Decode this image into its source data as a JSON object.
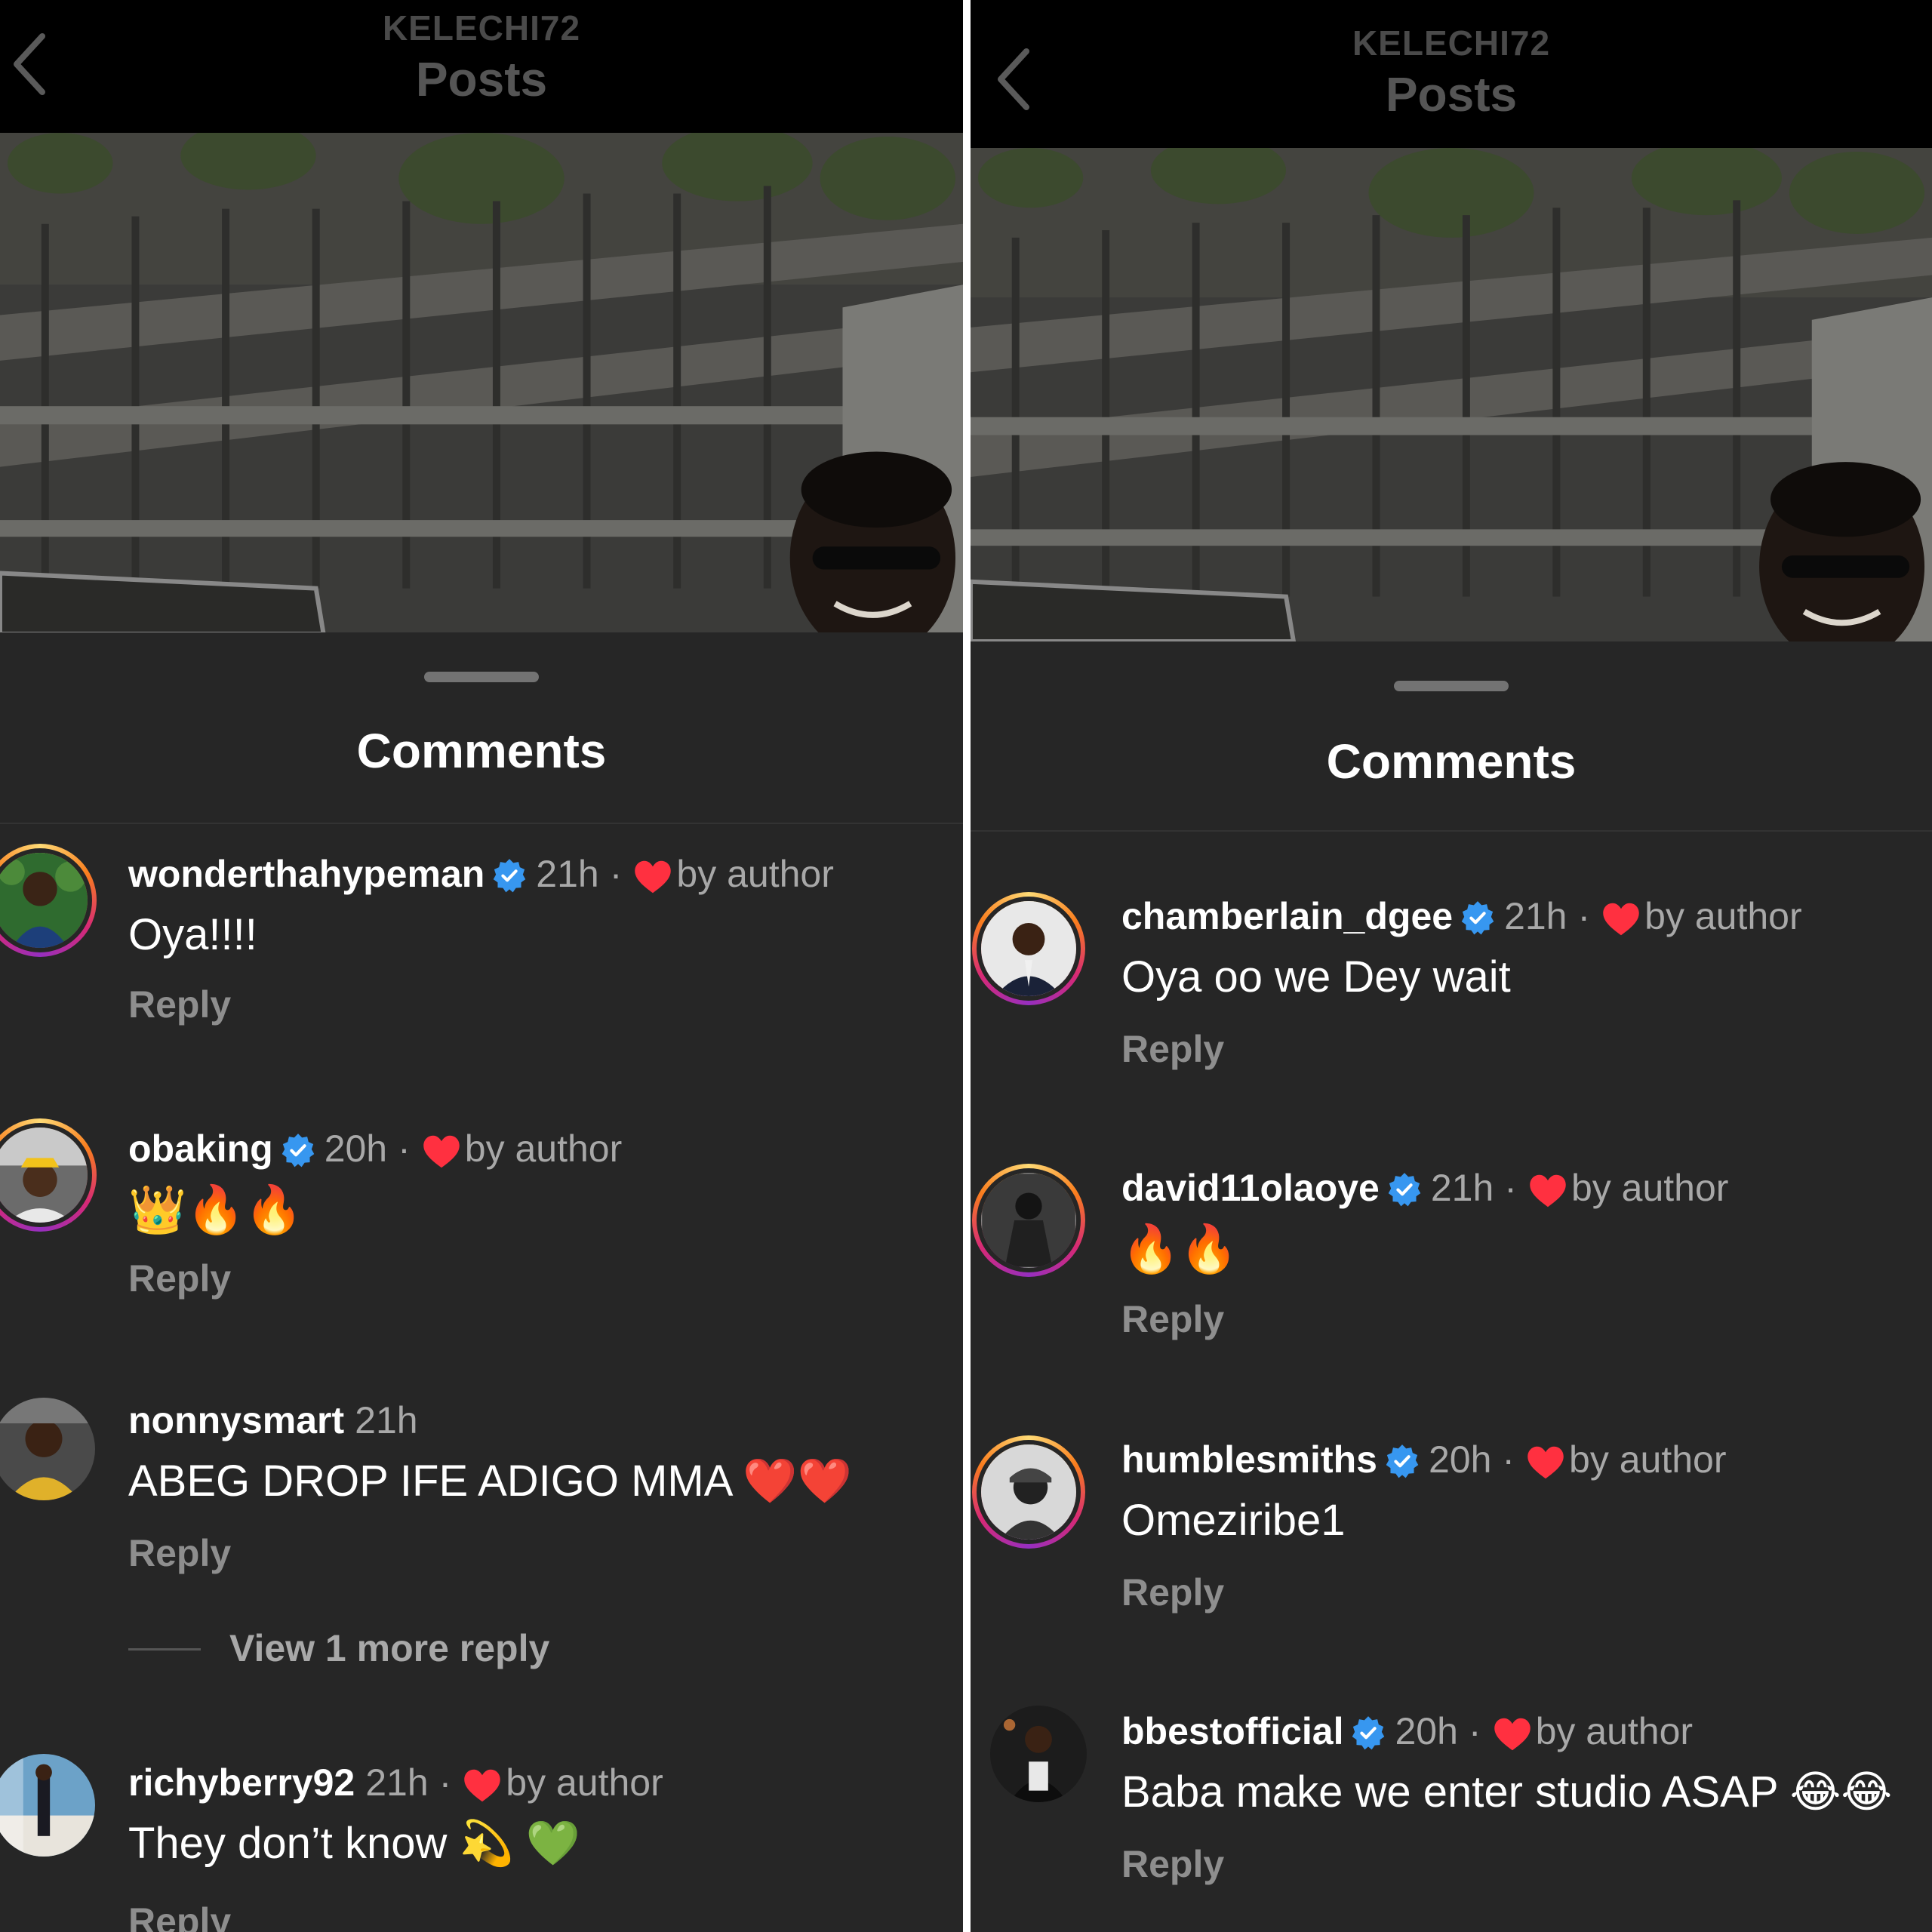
{
  "header": {
    "owner": "KELECHI72",
    "title": "Posts"
  },
  "sheet": {
    "title": "Comments"
  },
  "colors": {
    "background": "#262626",
    "verified": "#3797f0",
    "heart": "#ff3040",
    "meta": "#a8a8a8"
  },
  "left_panel": {
    "comments": [
      {
        "username": "wonderthahypeman",
        "verified": true,
        "time": "21h",
        "liked_by_author": true,
        "text": "Oya!!!!",
        "reply_label": "Reply"
      },
      {
        "username": "obaking",
        "verified": true,
        "time": "20h",
        "liked_by_author": true,
        "text": "👑🔥🔥",
        "reply_label": "Reply"
      },
      {
        "username": "nonnysmart",
        "verified": false,
        "time": "21h",
        "liked_by_author": false,
        "text": "ABEG DROP IFE ADIGO MMA ❤️❤️",
        "reply_label": "Reply",
        "view_more": "View 1 more reply"
      },
      {
        "username": "richyberry92",
        "verified": false,
        "time": "21h",
        "liked_by_author": true,
        "text": "They don’t know 💫 💚",
        "reply_label": "Reply"
      }
    ]
  },
  "right_panel": {
    "comments": [
      {
        "username": "chamberlain_dgee",
        "verified": true,
        "time": "21h",
        "liked_by_author": true,
        "text": "Oya oo we Dey wait",
        "reply_label": "Reply"
      },
      {
        "username": "david11olaoye",
        "verified": true,
        "time": "21h",
        "liked_by_author": true,
        "text": "🔥🔥",
        "reply_label": "Reply"
      },
      {
        "username": "humblesmiths",
        "verified": true,
        "time": "20h",
        "liked_by_author": true,
        "text": "Omeziribe1",
        "reply_label": "Reply"
      },
      {
        "username": "bbestofficial",
        "verified": true,
        "time": "20h",
        "liked_by_author": true,
        "text": "Baba make we enter studio ASAP 😂😂",
        "reply_label": "Reply"
      }
    ]
  },
  "labels": {
    "by_author": "by author",
    "separator": "·"
  }
}
